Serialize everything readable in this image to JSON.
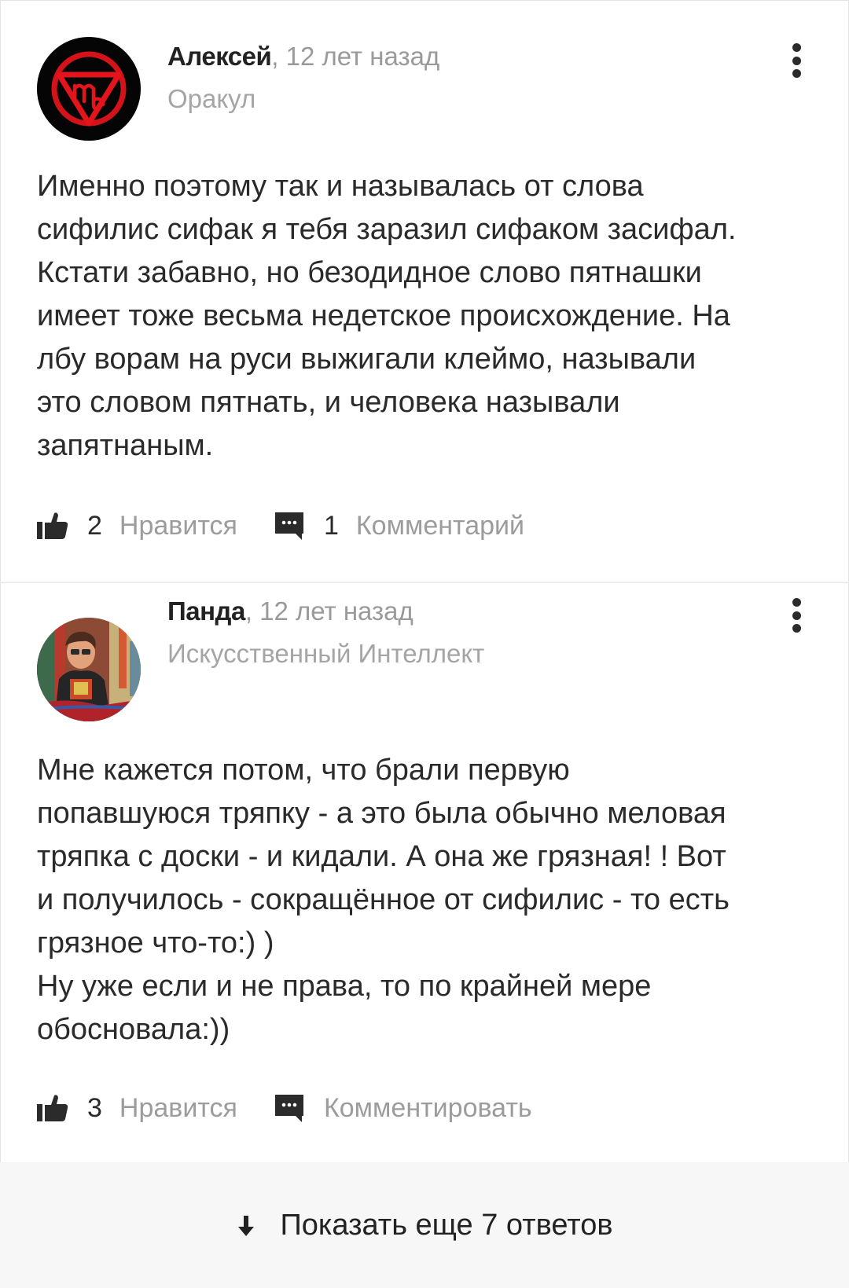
{
  "comments": [
    {
      "author": "Алексей",
      "time": ", 12 лет назад",
      "rank": "Оракул",
      "avatar_icon": "virgo-zodiac-icon",
      "text": "Именно поэтому так и называлась от слова\nсифилис сифак я тебя заразил сифаком засифал.\nКстати забавно, но безодидное слово пятнашки\nимеет тоже весьма недетское происхождение. На\nлбу ворам на руси выжигали клеймо, называли\nэто словом пятнать, и человека называли\nзапятнаным.",
      "likes_count": "2",
      "likes_label": "Нравится",
      "comments_count": "1",
      "comments_label": "Комментарий"
    },
    {
      "author": "Панда",
      "time": ", 12 лет назад",
      "rank": "Искусственный Интеллект",
      "avatar_icon": "user-photo-avatar",
      "text": "Мне кажется потом, что брали первую\nпопавшуюся тряпку - а это была обычно меловая\nтряпка с доски - и кидали. А она же грязная! ! Вот\nи получилось - сокращённое от сифилис - то есть\nгрязное что-то:) )\nНу уже если и не права, то по крайней мере\nобосновала:))",
      "likes_count": "3",
      "likes_label": "Нравится",
      "comments_count": "",
      "comments_label": "Комментировать"
    }
  ],
  "show_more_label": "Показать еще 7 ответов",
  "icons": {
    "like": "thumbs-up-icon",
    "comment": "speech-bubble-icon",
    "menu": "vertical-dots-icon",
    "show_more": "arrow-down-icon"
  },
  "colors": {
    "accent_red": "#e3141b",
    "muted_text": "#9c9c9c",
    "icon_dark": "#2b2b2b"
  }
}
